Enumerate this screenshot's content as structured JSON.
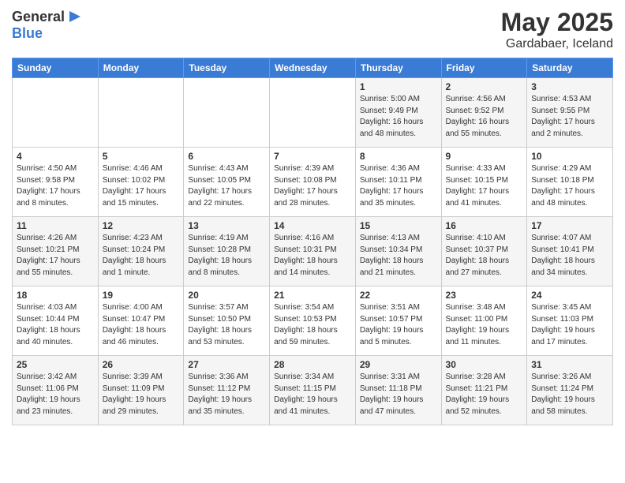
{
  "header": {
    "logo_general": "General",
    "logo_blue": "Blue",
    "title": "May 2025",
    "subtitle": "Gardabaer, Iceland"
  },
  "days_of_week": [
    "Sunday",
    "Monday",
    "Tuesday",
    "Wednesday",
    "Thursday",
    "Friday",
    "Saturday"
  ],
  "weeks": [
    [
      {
        "day": "",
        "info": ""
      },
      {
        "day": "",
        "info": ""
      },
      {
        "day": "",
        "info": ""
      },
      {
        "day": "",
        "info": ""
      },
      {
        "day": "1",
        "info": "Sunrise: 5:00 AM\nSunset: 9:49 PM\nDaylight: 16 hours\nand 48 minutes."
      },
      {
        "day": "2",
        "info": "Sunrise: 4:56 AM\nSunset: 9:52 PM\nDaylight: 16 hours\nand 55 minutes."
      },
      {
        "day": "3",
        "info": "Sunrise: 4:53 AM\nSunset: 9:55 PM\nDaylight: 17 hours\nand 2 minutes."
      }
    ],
    [
      {
        "day": "4",
        "info": "Sunrise: 4:50 AM\nSunset: 9:58 PM\nDaylight: 17 hours\nand 8 minutes."
      },
      {
        "day": "5",
        "info": "Sunrise: 4:46 AM\nSunset: 10:02 PM\nDaylight: 17 hours\nand 15 minutes."
      },
      {
        "day": "6",
        "info": "Sunrise: 4:43 AM\nSunset: 10:05 PM\nDaylight: 17 hours\nand 22 minutes."
      },
      {
        "day": "7",
        "info": "Sunrise: 4:39 AM\nSunset: 10:08 PM\nDaylight: 17 hours\nand 28 minutes."
      },
      {
        "day": "8",
        "info": "Sunrise: 4:36 AM\nSunset: 10:11 PM\nDaylight: 17 hours\nand 35 minutes."
      },
      {
        "day": "9",
        "info": "Sunrise: 4:33 AM\nSunset: 10:15 PM\nDaylight: 17 hours\nand 41 minutes."
      },
      {
        "day": "10",
        "info": "Sunrise: 4:29 AM\nSunset: 10:18 PM\nDaylight: 17 hours\nand 48 minutes."
      }
    ],
    [
      {
        "day": "11",
        "info": "Sunrise: 4:26 AM\nSunset: 10:21 PM\nDaylight: 17 hours\nand 55 minutes."
      },
      {
        "day": "12",
        "info": "Sunrise: 4:23 AM\nSunset: 10:24 PM\nDaylight: 18 hours\nand 1 minute."
      },
      {
        "day": "13",
        "info": "Sunrise: 4:19 AM\nSunset: 10:28 PM\nDaylight: 18 hours\nand 8 minutes."
      },
      {
        "day": "14",
        "info": "Sunrise: 4:16 AM\nSunset: 10:31 PM\nDaylight: 18 hours\nand 14 minutes."
      },
      {
        "day": "15",
        "info": "Sunrise: 4:13 AM\nSunset: 10:34 PM\nDaylight: 18 hours\nand 21 minutes."
      },
      {
        "day": "16",
        "info": "Sunrise: 4:10 AM\nSunset: 10:37 PM\nDaylight: 18 hours\nand 27 minutes."
      },
      {
        "day": "17",
        "info": "Sunrise: 4:07 AM\nSunset: 10:41 PM\nDaylight: 18 hours\nand 34 minutes."
      }
    ],
    [
      {
        "day": "18",
        "info": "Sunrise: 4:03 AM\nSunset: 10:44 PM\nDaylight: 18 hours\nand 40 minutes."
      },
      {
        "day": "19",
        "info": "Sunrise: 4:00 AM\nSunset: 10:47 PM\nDaylight: 18 hours\nand 46 minutes."
      },
      {
        "day": "20",
        "info": "Sunrise: 3:57 AM\nSunset: 10:50 PM\nDaylight: 18 hours\nand 53 minutes."
      },
      {
        "day": "21",
        "info": "Sunrise: 3:54 AM\nSunset: 10:53 PM\nDaylight: 18 hours\nand 59 minutes."
      },
      {
        "day": "22",
        "info": "Sunrise: 3:51 AM\nSunset: 10:57 PM\nDaylight: 19 hours\nand 5 minutes."
      },
      {
        "day": "23",
        "info": "Sunrise: 3:48 AM\nSunset: 11:00 PM\nDaylight: 19 hours\nand 11 minutes."
      },
      {
        "day": "24",
        "info": "Sunrise: 3:45 AM\nSunset: 11:03 PM\nDaylight: 19 hours\nand 17 minutes."
      }
    ],
    [
      {
        "day": "25",
        "info": "Sunrise: 3:42 AM\nSunset: 11:06 PM\nDaylight: 19 hours\nand 23 minutes."
      },
      {
        "day": "26",
        "info": "Sunrise: 3:39 AM\nSunset: 11:09 PM\nDaylight: 19 hours\nand 29 minutes."
      },
      {
        "day": "27",
        "info": "Sunrise: 3:36 AM\nSunset: 11:12 PM\nDaylight: 19 hours\nand 35 minutes."
      },
      {
        "day": "28",
        "info": "Sunrise: 3:34 AM\nSunset: 11:15 PM\nDaylight: 19 hours\nand 41 minutes."
      },
      {
        "day": "29",
        "info": "Sunrise: 3:31 AM\nSunset: 11:18 PM\nDaylight: 19 hours\nand 47 minutes."
      },
      {
        "day": "30",
        "info": "Sunrise: 3:28 AM\nSunset: 11:21 PM\nDaylight: 19 hours\nand 52 minutes."
      },
      {
        "day": "31",
        "info": "Sunrise: 3:26 AM\nSunset: 11:24 PM\nDaylight: 19 hours\nand 58 minutes."
      }
    ]
  ]
}
